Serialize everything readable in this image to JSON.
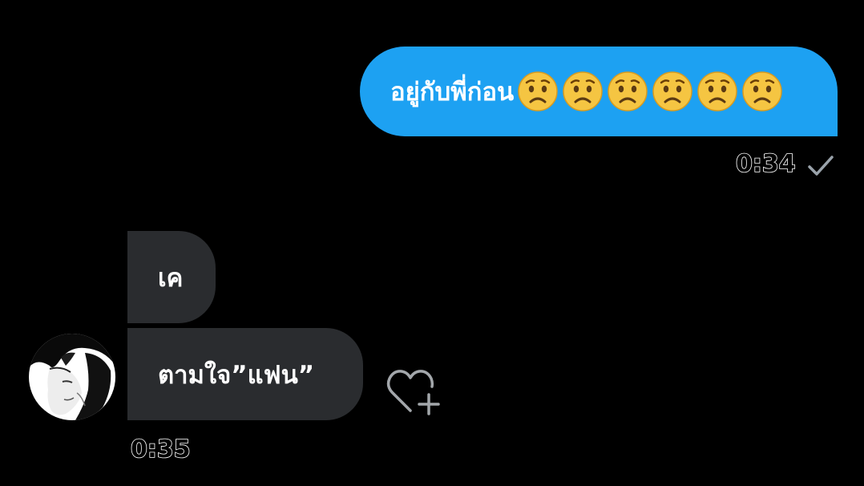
{
  "messages": {
    "sent": {
      "text": "อยู่กับพี่ก่อน",
      "emoji": [
        "worried-face",
        "worried-face",
        "worried-face",
        "worried-face",
        "worried-face",
        "worried-face"
      ],
      "time": "0:34",
      "status_icon": "check-icon"
    },
    "received": [
      {
        "text": "เค"
      },
      {
        "text": "ตามใจ”แฟน”"
      }
    ],
    "received_time": "0:35"
  },
  "avatar": {
    "icon": "avatar-photo"
  },
  "reaction": {
    "icon": "heart-plus-icon"
  },
  "colors": {
    "background": "#000000",
    "sent_bubble": "#1da1f2",
    "received_bubble": "#2a2c2f",
    "emoji_face": "#f5c542"
  }
}
